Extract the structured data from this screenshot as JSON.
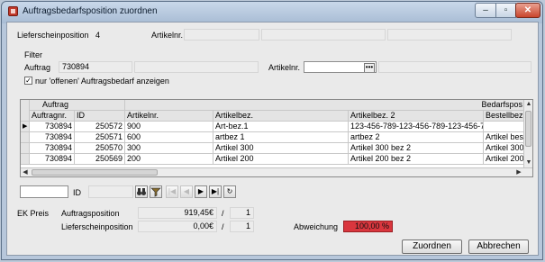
{
  "window": {
    "title": "Auftragsbedarfsposition zuordnen",
    "controls": {
      "minimize": "–",
      "maximize": "▫",
      "close": "✕"
    }
  },
  "header": {
    "lieferscheinposition_label": "Lieferscheinposition",
    "lieferscheinposition_value": "4",
    "artikelnr_label": "Artikelnr."
  },
  "filter": {
    "title": "Filter",
    "auftrag_label": "Auftrag",
    "auftrag_value": "730894",
    "artikelnr_label": "Artikelnr.",
    "ellipsis": "•••",
    "checkbox_checked": true,
    "checkbox_mark": "✓",
    "checkbox_label": "nur 'offenen' Auftragsbedarf anzeigen"
  },
  "grid": {
    "group_headers": {
      "auftrag": "Auftrag",
      "bedarfspos": "Bedarfspos"
    },
    "columns": [
      "Auftragnr.",
      "ID",
      "Artikelnr.",
      "Artikelbez.",
      "Artikelbez. 2",
      "Bestellbez."
    ],
    "row_marker": "▶",
    "rows": [
      [
        "730894",
        "250572",
        "900",
        "Art-bez.1",
        "123-456-789-123-456-789-123-456-78",
        ""
      ],
      [
        "730894",
        "250571",
        "600",
        "artbez 1",
        "artbez 2",
        "Artikel best"
      ],
      [
        "730894",
        "250570",
        "300",
        "Artikel 300",
        "Artikel 300 bez 2",
        "Artikel 300"
      ],
      [
        "730894",
        "250569",
        "200",
        "Artikel 200",
        "Artikel 200 bez 2",
        "Artikel 200"
      ]
    ]
  },
  "navigator": {
    "id_label": "ID",
    "buttons": [
      "binoculars-icon",
      "filter-icon",
      "|◀",
      "◀",
      "▶",
      "▶|",
      "↻"
    ]
  },
  "prices": {
    "ek_label": "EK Preis",
    "auftragsposition_label": "Auftragsposition",
    "auftragsposition_value": "919,45€",
    "auftragsposition_qty": "1",
    "lieferscheinposition_label": "Lieferscheinposition",
    "lieferscheinposition_value": "0,00€",
    "lieferscheinposition_qty": "1",
    "slash": "/",
    "abweichung_label": "Abweichung",
    "abweichung_value": "100,00 %",
    "abweichung_color": "#d9363e"
  },
  "buttons": {
    "zuordnen": "Zuordnen",
    "abbrechen": "Abbrechen"
  }
}
